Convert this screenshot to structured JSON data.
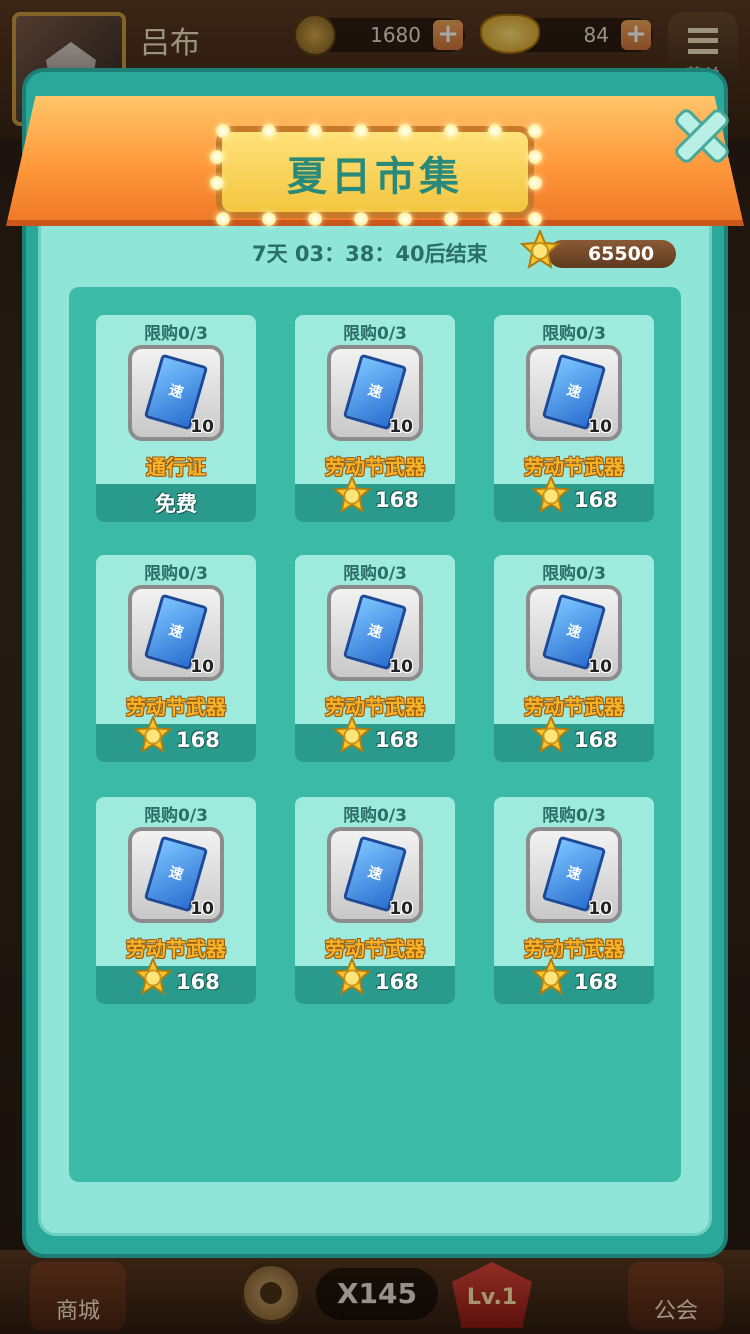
{
  "player": {
    "name": "吕布"
  },
  "resources": {
    "coins": "1680",
    "gold": "84"
  },
  "menu": {
    "label": "菜单"
  },
  "bottom_bar": {
    "shop_label": "商城",
    "count_label": "X145",
    "level_label": "Lv.1",
    "guild_label": "公会"
  },
  "shop": {
    "title": "夏日市集",
    "timer": "7天 03：38：40后结束",
    "balance": "65500",
    "items": [
      {
        "limit": "限购0/3",
        "qty": "10",
        "ticket_char": "速",
        "name": "通行证",
        "price": "免费",
        "free": true
      },
      {
        "limit": "限购0/3",
        "qty": "10",
        "ticket_char": "速",
        "name": "劳动节武器",
        "price": "168",
        "free": false
      },
      {
        "limit": "限购0/3",
        "qty": "10",
        "ticket_char": "速",
        "name": "劳动节武器",
        "price": "168",
        "free": false
      },
      {
        "limit": "限购0/3",
        "qty": "10",
        "ticket_char": "速",
        "name": "劳动节武器",
        "price": "168",
        "free": false
      },
      {
        "limit": "限购0/3",
        "qty": "10",
        "ticket_char": "速",
        "name": "劳动节武器",
        "price": "168",
        "free": false
      },
      {
        "limit": "限购0/3",
        "qty": "10",
        "ticket_char": "速",
        "name": "劳动节武器",
        "price": "168",
        "free": false
      },
      {
        "limit": "限购0/3",
        "qty": "10",
        "ticket_char": "速",
        "name": "劳动节武器",
        "price": "168",
        "free": false
      },
      {
        "limit": "限购0/3",
        "qty": "10",
        "ticket_char": "速",
        "name": "劳动节武器",
        "price": "168",
        "free": false
      },
      {
        "limit": "限购0/3",
        "qty": "10",
        "ticket_char": "速",
        "name": "劳动节武器",
        "price": "168",
        "free": false
      }
    ]
  },
  "colors": {
    "panel": "#2aa89a",
    "panel_inner": "#8fe6d8",
    "banner": "#ff9a3c",
    "title_plate": "#f3c640",
    "item_name": "#f7b428"
  },
  "icons": {
    "currency": "star-coin-icon",
    "item": "speed-ticket-icon",
    "close": "close-icon"
  }
}
